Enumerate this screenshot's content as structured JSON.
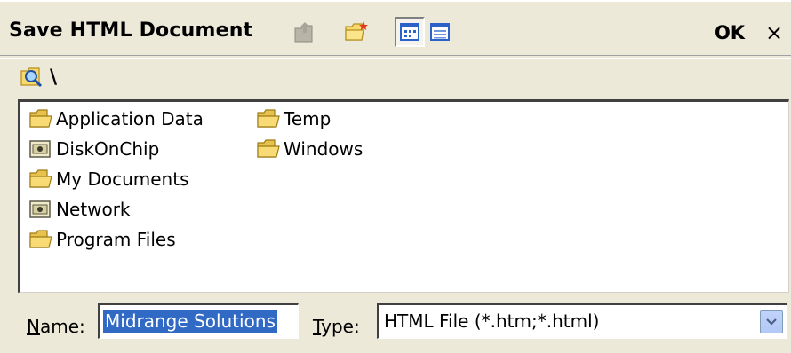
{
  "dialog": {
    "title": "Save HTML Document",
    "ok_label": "OK",
    "close_label": "×"
  },
  "toolbar": {
    "icons": [
      "up-folder-icon",
      "new-folder-icon",
      "list-view-icon",
      "details-view-icon"
    ]
  },
  "path": {
    "text": "\\"
  },
  "files": [
    {
      "label": "Application Data",
      "icon": "folder-icon"
    },
    {
      "label": "DiskOnChip",
      "icon": "storage-folder-icon"
    },
    {
      "label": "My Documents",
      "icon": "folder-icon"
    },
    {
      "label": "Network",
      "icon": "storage-folder-icon"
    },
    {
      "label": "Program Files",
      "icon": "folder-icon"
    },
    {
      "label": "Temp",
      "icon": "folder-icon"
    },
    {
      "label": "Windows",
      "icon": "folder-icon"
    }
  ],
  "name_field": {
    "label_prefix": "N",
    "label_rest": "ame:",
    "value": "Midrange Solutions"
  },
  "type_field": {
    "label_prefix": "T",
    "label_rest": "ype:",
    "value": "HTML File (*.htm;*.html)"
  },
  "colors": {
    "background": "#ece9d8",
    "selection": "#316ac5",
    "folder": "#f6d96a"
  }
}
